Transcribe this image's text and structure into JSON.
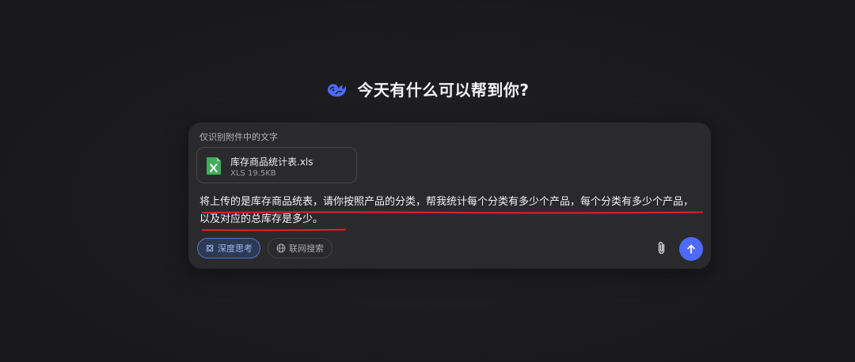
{
  "header": {
    "title": "今天有什么可以帮到你?"
  },
  "composer": {
    "hint": "仅识别附件中的文字",
    "attachment": {
      "name": "库存商品统计表.xls",
      "size": "XLS 19.5KB"
    },
    "prompt": "将上传的是库存商品统表，请你按照产品的分类，帮我统计每个分类有多少个产品，每个分类有多少个产品，以及对应的总库存是多少。",
    "buttons": {
      "deep_think": "深度思考",
      "web_search": "联网搜索"
    }
  },
  "colors": {
    "accent": "#4d6bfe",
    "excel_green": "#3fae5a",
    "annotation_red": "#e0202a"
  },
  "icons": {
    "logo": "whale-logo-icon",
    "file": "excel-file-icon",
    "deep_think": "atom-icon",
    "web_search": "globe-icon",
    "attach": "paperclip-icon",
    "send": "arrow-up-icon"
  }
}
